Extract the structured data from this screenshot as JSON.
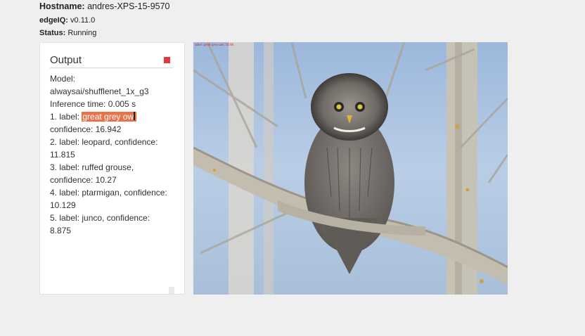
{
  "header": {
    "hostname_label": "Hostname:",
    "hostname_value": "andres-XPS-15-9570",
    "edgeiq_label": "edgeIQ:",
    "edgeiq_value": "v0.11.0",
    "status_label": "Status:",
    "status_value": "Running"
  },
  "output": {
    "title": "Output",
    "model_label": "Model:",
    "model_value": "alwaysai/shufflenet_1x_g3",
    "inference": "Inference time: 0.005 s",
    "results": [
      {
        "prefix": "1. label: ",
        "label": "great grey owl",
        "confidence": "confidence: 16.942"
      },
      {
        "text_a": "2. label: leopard, confidence:",
        "text_b": "11.815"
      },
      {
        "text_a": "3. label: ruffed grouse,",
        "text_b": "confidence: 10.27"
      },
      {
        "text_a": "4. label: ptarmigan, confidence:",
        "text_b": "10.129"
      },
      {
        "text_a": "5. label: junco, confidence:",
        "text_b": "8.875"
      }
    ],
    "stop_color": "#e0393e"
  },
  "image": {
    "overlay": "label: great grey owl, 16.94"
  }
}
